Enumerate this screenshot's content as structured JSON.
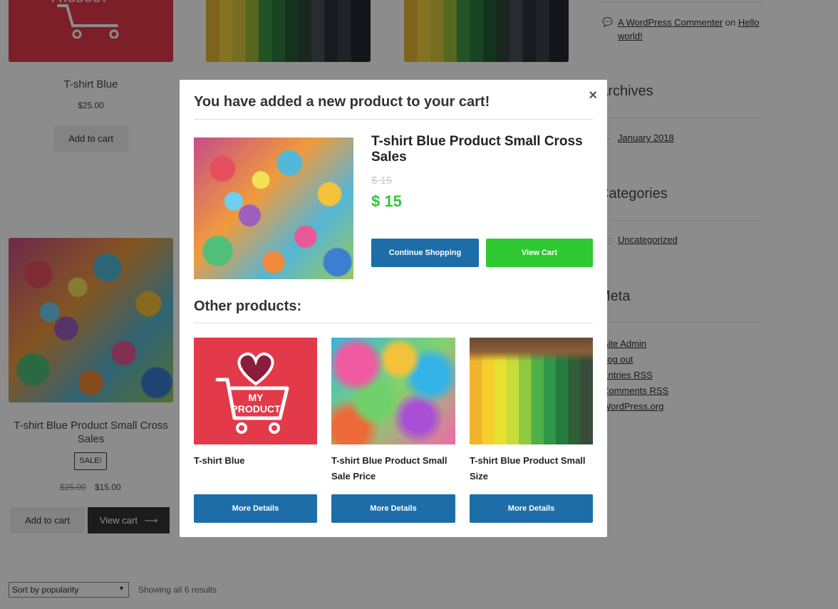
{
  "background": {
    "products": [
      {
        "title": "T-shirt Blue",
        "price": "$25.00",
        "button": "Add to cart"
      },
      {
        "title": "T-shirt Blue Product Small Cross Sales",
        "sale_badge": "SALE!",
        "old_price": "$25.00",
        "price": "$15.00",
        "button": "Add to cart",
        "view_cart": "View cart"
      }
    ],
    "logo_text": "PRODUCT",
    "sort": {
      "selected": "Sort by popularity"
    },
    "results": "Showing all 6 results"
  },
  "sidebar": {
    "comment": {
      "author": "A WordPress Commenter",
      "on": "on",
      "post": "Hello world!"
    },
    "archives": {
      "title": "Archives",
      "items": [
        "January 2018"
      ]
    },
    "categories": {
      "title": "Categories",
      "items": [
        "Uncategorized"
      ]
    },
    "meta": {
      "title": "Meta",
      "items": [
        "Site Admin",
        "Log out",
        "Entries RSS",
        "Comments RSS",
        "WordPress.org"
      ]
    }
  },
  "modal": {
    "heading": "You have added a new product to your cart!",
    "close_glyph": "×",
    "product": {
      "name": "T-shirt Blue Product Small Cross Sales",
      "old_price": "$ 15",
      "price": "$ 15"
    },
    "continue_label": "Continue Shopping",
    "view_cart_label": "View Cart",
    "other_heading": "Other products:",
    "others": [
      {
        "title": "T-shirt Blue",
        "button": "More Details",
        "image_text": [
          "MY",
          "PRODUCT"
        ]
      },
      {
        "title": "T-shirt Blue Product Small Sale Price",
        "button": "More Details"
      },
      {
        "title": "T-shirt Blue Product Small Size",
        "button": "More Details"
      }
    ]
  },
  "colors": {
    "accent_blue": "#1d6ea8",
    "accent_green": "#2ec931",
    "logo_red": "#e33a4a",
    "price_green": "#2ec931"
  }
}
